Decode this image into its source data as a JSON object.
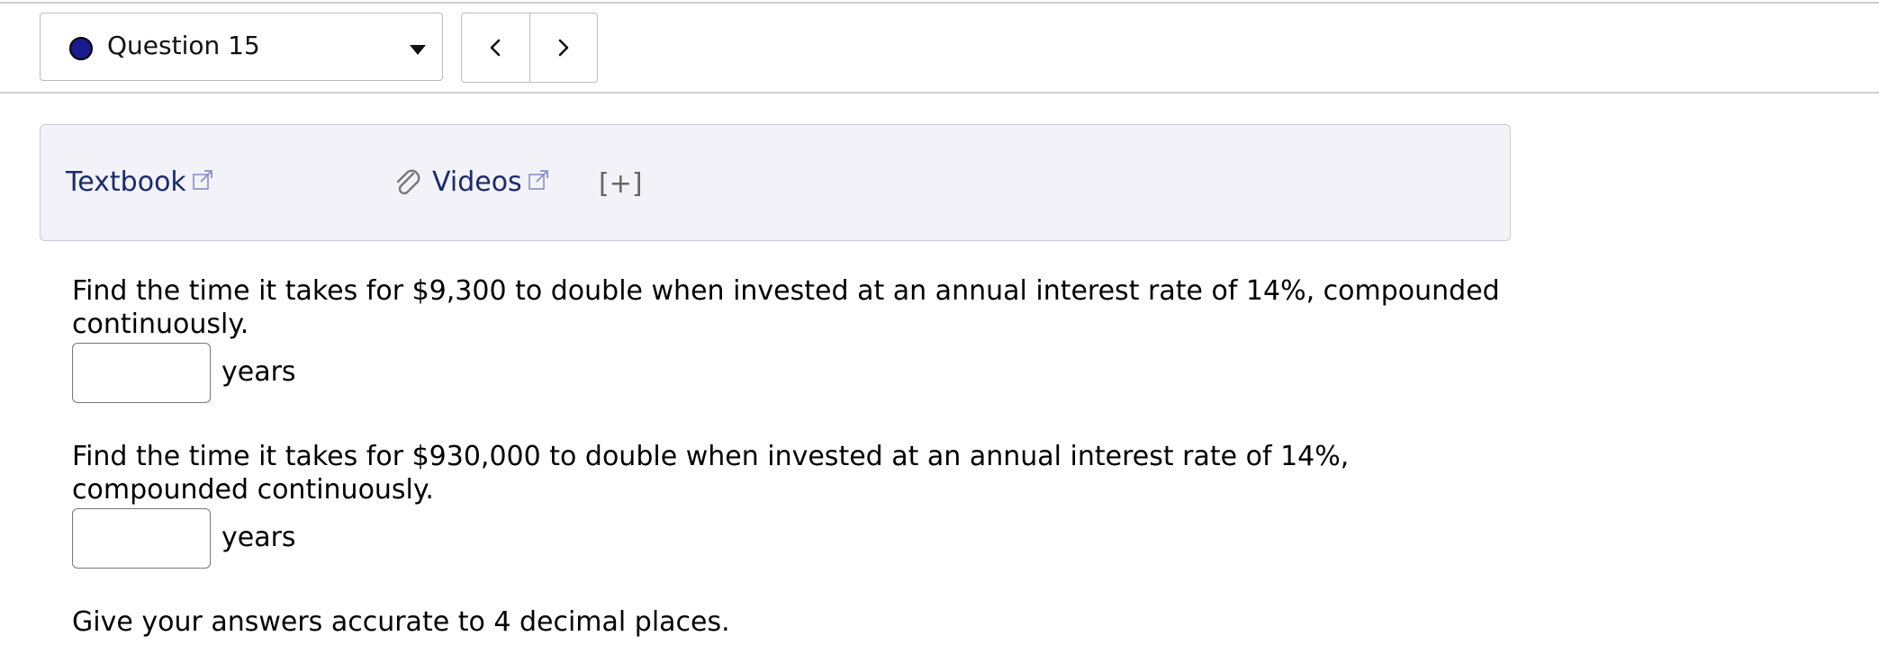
{
  "nav": {
    "question_label": "Question 15",
    "status_color": "#1a1a8f",
    "prev_icon": "chevron-left-icon",
    "next_icon": "chevron-right-icon"
  },
  "resources": {
    "textbook_label": "Textbook",
    "videos_label": "Videos",
    "expand_label": "[+]",
    "link_color": "#1a2a6c"
  },
  "questions": [
    {
      "text": "Find the time it takes for $9,300 to double when invested at an annual interest rate of 14%, compounded continuously.",
      "answer_value": "",
      "unit": "years"
    },
    {
      "text": "Find the time it takes for $930,000 to double when invested at an annual interest rate of 14%, compounded continuously.",
      "answer_value": "",
      "unit": "years"
    }
  ],
  "instructions": "Give your answers accurate to 4 decimal places."
}
